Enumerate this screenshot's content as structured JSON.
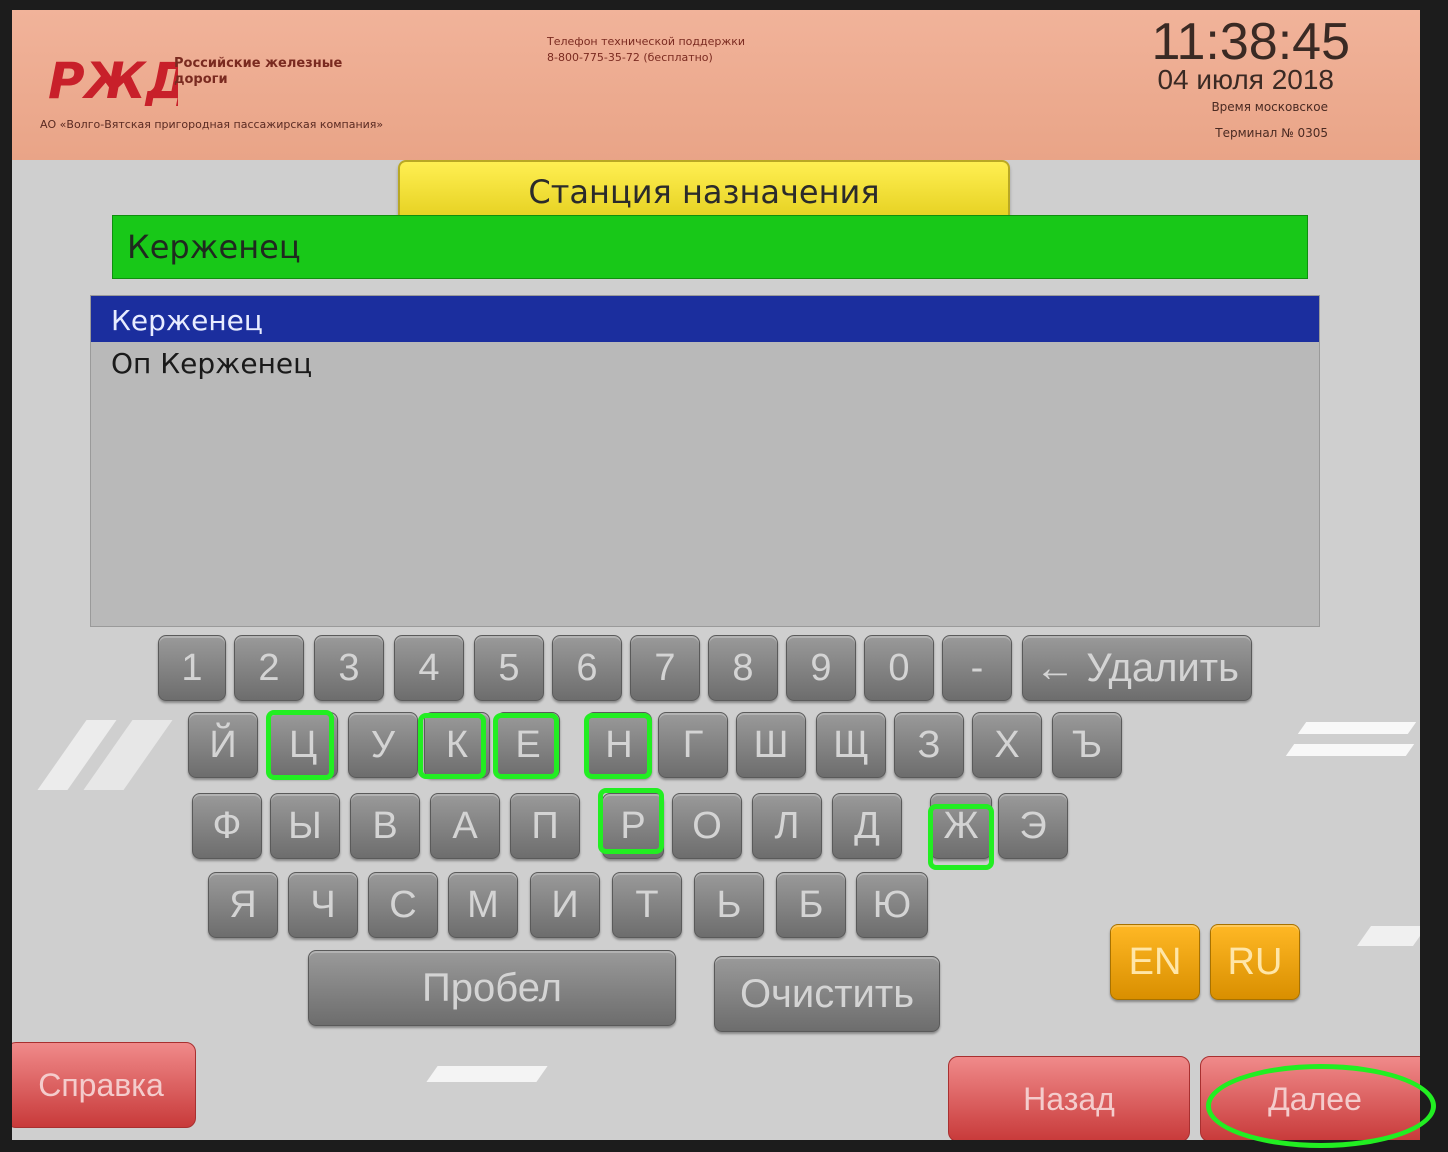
{
  "header": {
    "brand_name": "Российские железные дороги",
    "company": "АО «Волго-Вятская пригородная пассажирская компания»",
    "support_line1": "Телефон технической поддержки",
    "support_line2": "8-800-775-35-72 (бесплатно)",
    "time": "11:38:45",
    "date": "04 июля 2018",
    "timezone": "Время московское",
    "terminal": "Терминал № 0305"
  },
  "screen_title": "Станция назначения",
  "search": {
    "value": "Керженец"
  },
  "results": [
    {
      "label": "Керженец",
      "selected": true
    },
    {
      "label": "Оп Керженец",
      "selected": false
    }
  ],
  "keyboard": {
    "row1": [
      "1",
      "2",
      "3",
      "4",
      "5",
      "6",
      "7",
      "8",
      "9",
      "0",
      "-"
    ],
    "delete_label": "← Удалить",
    "row2": [
      "Й",
      "Ц",
      "У",
      "К",
      "Е",
      "Н",
      "Г",
      "Ш",
      "Щ",
      "З",
      "Х",
      "Ъ"
    ],
    "row3": [
      "Ф",
      "Ы",
      "В",
      "А",
      "П",
      "Р",
      "О",
      "Л",
      "Д",
      "Ж",
      "Э"
    ],
    "row4": [
      "Я",
      "Ч",
      "С",
      "М",
      "И",
      "Т",
      "Ь",
      "Б",
      "Ю"
    ],
    "space_label": "Пробел",
    "clear_label": "Очистить",
    "lang_en": "EN",
    "lang_ru": "RU"
  },
  "footer": {
    "help_label": "Справка",
    "back_label": "Назад",
    "next_label": "Далее"
  },
  "colors": {
    "header": "#e9a487",
    "title_plate": "#f2de36",
    "input_bar": "#18c818",
    "selected_row": "#1b2e9e",
    "key": "#858585",
    "lang_key": "#f2a40f",
    "footer_button": "#d85050",
    "annotation": "#22ee22"
  }
}
